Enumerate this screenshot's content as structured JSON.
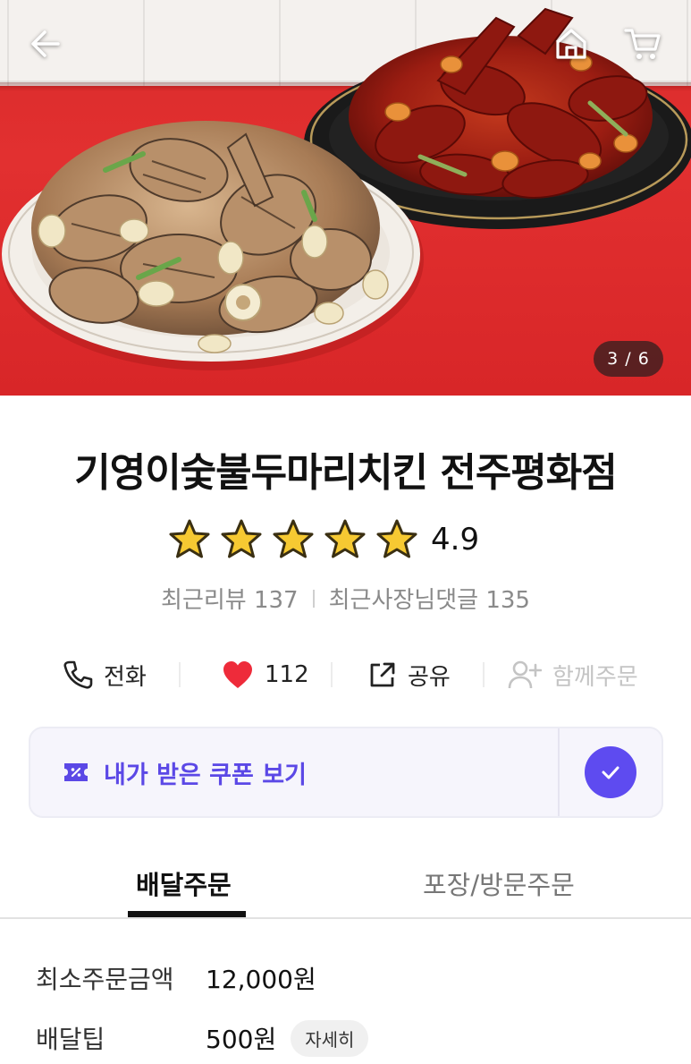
{
  "hero": {
    "image_counter": "3 / 6",
    "icons": {
      "back": "arrow-left-icon",
      "home": "home-icon",
      "cart": "cart-icon"
    }
  },
  "store": {
    "name": "기영이숯불두마리치킨 전주평화점",
    "rating": "4.9",
    "rating_stars": 5,
    "recent_reviews": "최근리뷰 137",
    "recent_owner_replies": "최근사장님댓글 135"
  },
  "actions": {
    "call_label": "전화",
    "like_count": "112",
    "share_label": "공유",
    "group_order_label": "함께주문"
  },
  "coupon": {
    "label": "내가 받은 쿠폰 보기",
    "accent": "#5b48e6"
  },
  "tabs": [
    {
      "label": "배달주문",
      "active": true
    },
    {
      "label": "포장/방문주문",
      "active": false
    }
  ],
  "info": {
    "min_order_label": "최소주문금액",
    "min_order_value": "12,000원",
    "delivery_tip_label": "배달팁",
    "delivery_tip_value": "500원",
    "detail_button": "자세히"
  },
  "colors": {
    "heart": "#ee2b3a",
    "star_fill": "#f6c932",
    "star_stroke": "#3a2f12",
    "check_bg": "#5e4bf0"
  }
}
